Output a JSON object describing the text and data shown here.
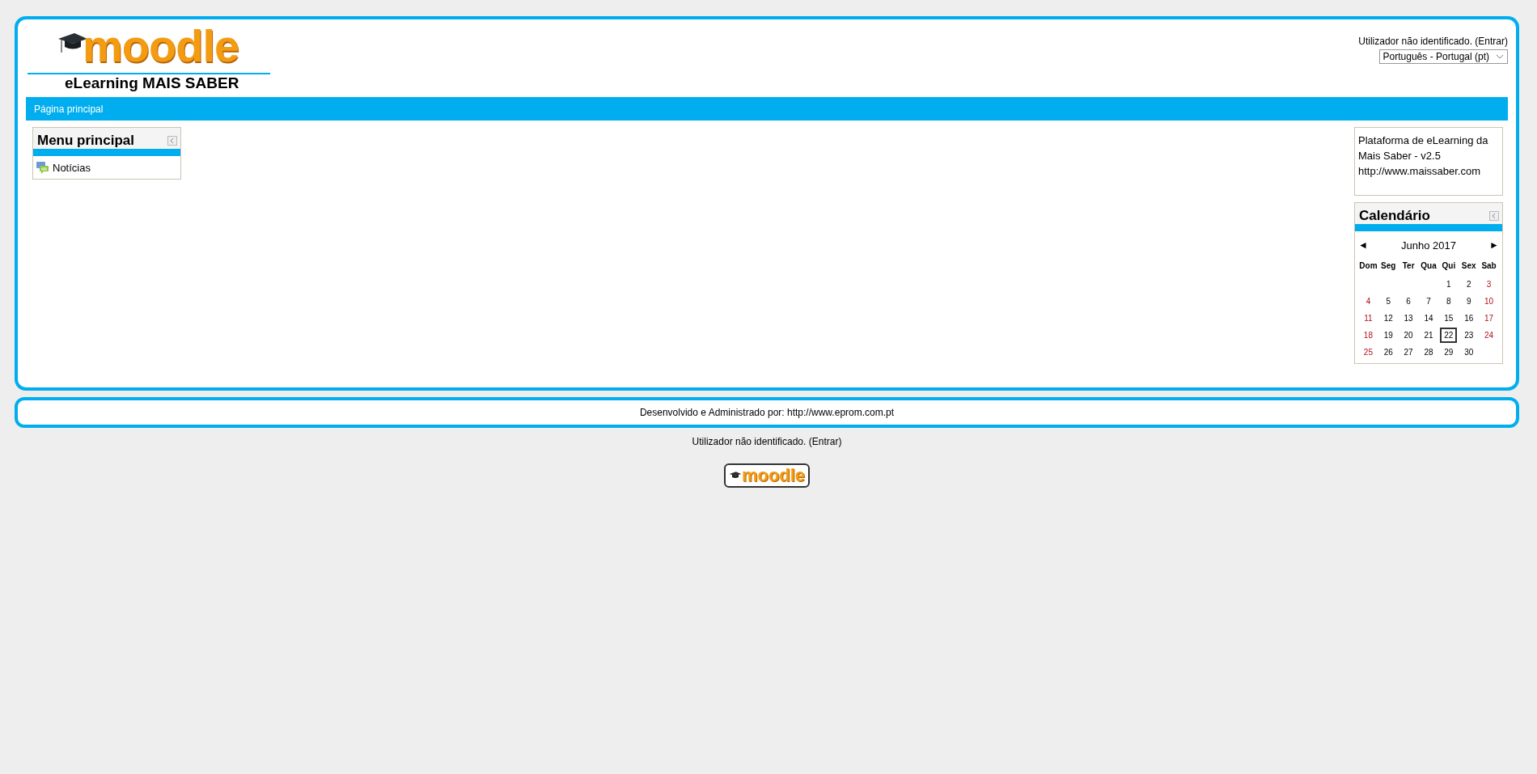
{
  "logo": {
    "wordmark": "moodle",
    "subtitle": "eLearning MAIS SABER"
  },
  "login_top": {
    "text": "Utilizador não identificado.",
    "link": "(Entrar)"
  },
  "language_select": {
    "value": "Português - Portugal (pt)"
  },
  "navbar": {
    "breadcrumb": "Página principal"
  },
  "main_menu": {
    "title": "Menu principal",
    "items": [
      {
        "label": "Notícias"
      }
    ]
  },
  "about_block": {
    "lines": [
      "Plataforma de eLearning da Mais Saber - v2.5",
      "http://www.maissaber.com"
    ]
  },
  "calendar": {
    "title": "Calendário",
    "prev": "◄",
    "month": "Junho 2017",
    "next": "►",
    "weekdays": [
      "Dom",
      "Seg",
      "Ter",
      "Qua",
      "Qui",
      "Sex",
      "Sab"
    ],
    "weeks": [
      [
        {
          "day": "1",
          "today": false
        },
        {
          "day": "2",
          "today": false
        },
        {
          "day": "3",
          "today": false
        }
      ],
      [
        {
          "day": "4",
          "today": false
        },
        {
          "day": "5",
          "today": false
        },
        {
          "day": "6",
          "today": false
        },
        {
          "day": "7",
          "today": false
        },
        {
          "day": "8",
          "today": false
        },
        {
          "day": "9",
          "today": false
        },
        {
          "day": "10",
          "today": false
        }
      ],
      [
        {
          "day": "11",
          "today": false
        },
        {
          "day": "12",
          "today": false
        },
        {
          "day": "13",
          "today": false
        },
        {
          "day": "14",
          "today": false
        },
        {
          "day": "15",
          "today": false
        },
        {
          "day": "16",
          "today": false
        },
        {
          "day": "17",
          "today": false
        }
      ],
      [
        {
          "day": "18",
          "today": false
        },
        {
          "day": "19",
          "today": false
        },
        {
          "day": "20",
          "today": false
        },
        {
          "day": "21",
          "today": false
        },
        {
          "day": "22",
          "today": true
        },
        {
          "day": "23",
          "today": false
        },
        {
          "day": "24",
          "today": false
        }
      ],
      [
        {
          "day": "25",
          "today": false
        },
        {
          "day": "26",
          "today": false
        },
        {
          "day": "27",
          "today": false
        },
        {
          "day": "28",
          "today": false
        },
        {
          "day": "29",
          "today": false
        },
        {
          "day": "30",
          "today": false
        }
      ]
    ]
  },
  "footer": {
    "credit": "Desenvolvido e Administrado por: http://www.eprom.com.pt"
  },
  "login_bottom": {
    "text": "Utilizador não identificado.",
    "link": "(Entrar)"
  },
  "footer_logo": {
    "wordmark": "moodle"
  }
}
